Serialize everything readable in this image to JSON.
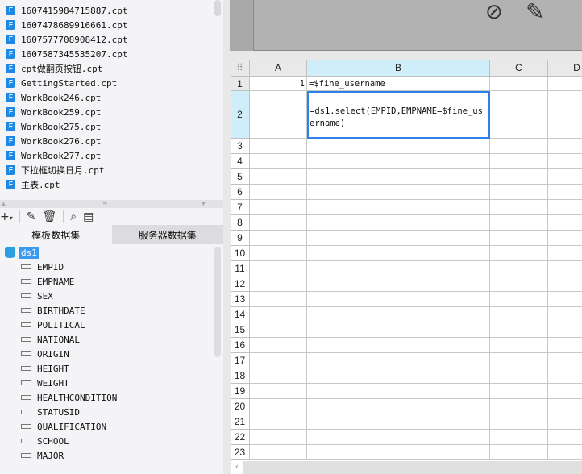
{
  "files": [
    "1607415984715887.cpt",
    "1607478689916661.cpt",
    "1607577708908412.cpt",
    "1607587345535207.cpt",
    "cpt做翻页按钮.cpt",
    "GettingStarted.cpt",
    "WorkBook246.cpt",
    "WorkBook259.cpt",
    "WorkBook275.cpt",
    "WorkBook276.cpt",
    "WorkBook277.cpt",
    "下拉框切换日月.cpt",
    "主表.cpt"
  ],
  "tabs": {
    "template": "模板数据集",
    "server": "服务器数据集"
  },
  "dataset": {
    "name": "ds1",
    "fields": [
      "EMPID",
      "EMPNAME",
      "SEX",
      "BIRTHDATE",
      "POLITICAL",
      "NATIONAL",
      "ORIGIN",
      "HEIGHT",
      "WEIGHT",
      "HEALTHCONDITION",
      "STATUSID",
      "QUALIFICATION",
      "SCHOOL",
      "MAJOR"
    ]
  },
  "sheet": {
    "columns": [
      "A",
      "B",
      "C",
      "D"
    ],
    "rows": [
      "1",
      "2",
      "3",
      "4",
      "5",
      "6",
      "7",
      "8",
      "9",
      "10",
      "11",
      "12",
      "13",
      "14",
      "15",
      "16",
      "17",
      "18",
      "19",
      "20",
      "21",
      "22",
      "23"
    ],
    "a1": "1",
    "b1": "=$fine_username",
    "b2": "=ds1.select(EMPID,EMPNAME=$fine_username)"
  },
  "colors": {
    "accent": "#2f7fe8",
    "selected_header": "#d0eefa"
  }
}
